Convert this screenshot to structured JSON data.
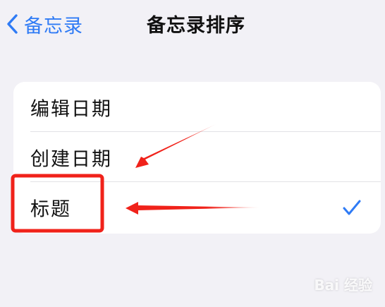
{
  "nav": {
    "back_label": "备忘录",
    "title": "备忘录排序"
  },
  "sort_options": [
    {
      "label": "编辑日期",
      "selected": false
    },
    {
      "label": "创建日期",
      "selected": false
    },
    {
      "label": "标题",
      "selected": true
    }
  ],
  "watermark": {
    "text": "Bai 经验"
  },
  "colors": {
    "accent": "#2f7bf5",
    "annotation_red": "#f0221a",
    "background": "#f2f1f6"
  }
}
